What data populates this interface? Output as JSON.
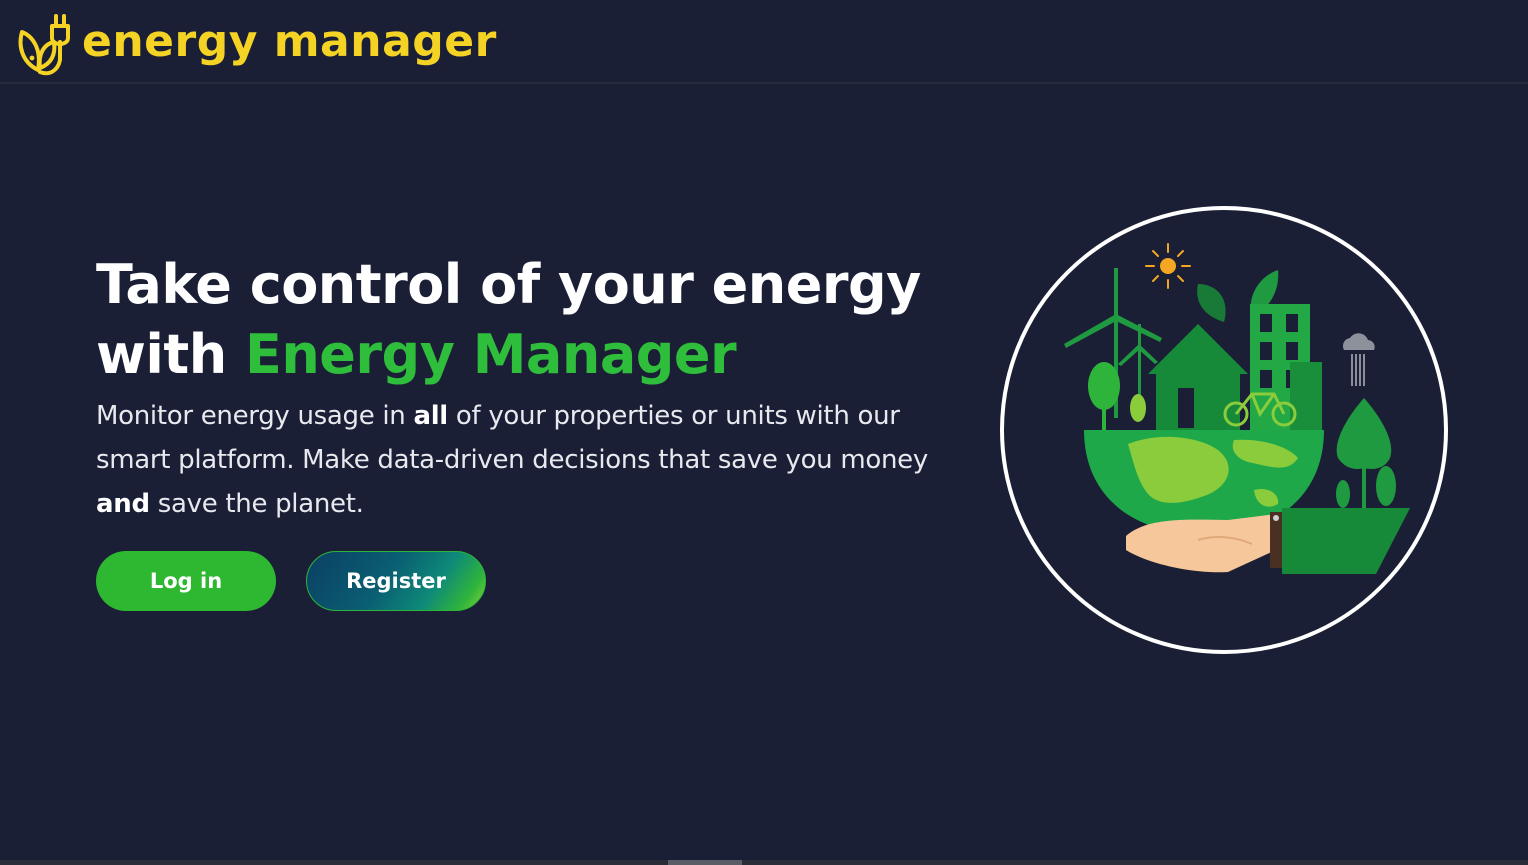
{
  "brand": {
    "name": "energy manager",
    "color": "#f4d325",
    "icon": "plug-leaf-icon"
  },
  "hero": {
    "headline_part1": "Take control of your energy",
    "headline_part2": "with ",
    "headline_accent": "Energy Manager",
    "accent_color": "#2fbe3b",
    "description": {
      "t1": "Monitor energy usage in ",
      "b1": "all",
      "t2": " of your properties or units with our smart platform. Make data-driven decisions that save you money ",
      "b2": "and",
      "t3": " save the planet."
    }
  },
  "actions": {
    "login_label": "Log in",
    "register_label": "Register"
  },
  "illustration": {
    "icon": "green-earth-in-hand-illustration"
  }
}
